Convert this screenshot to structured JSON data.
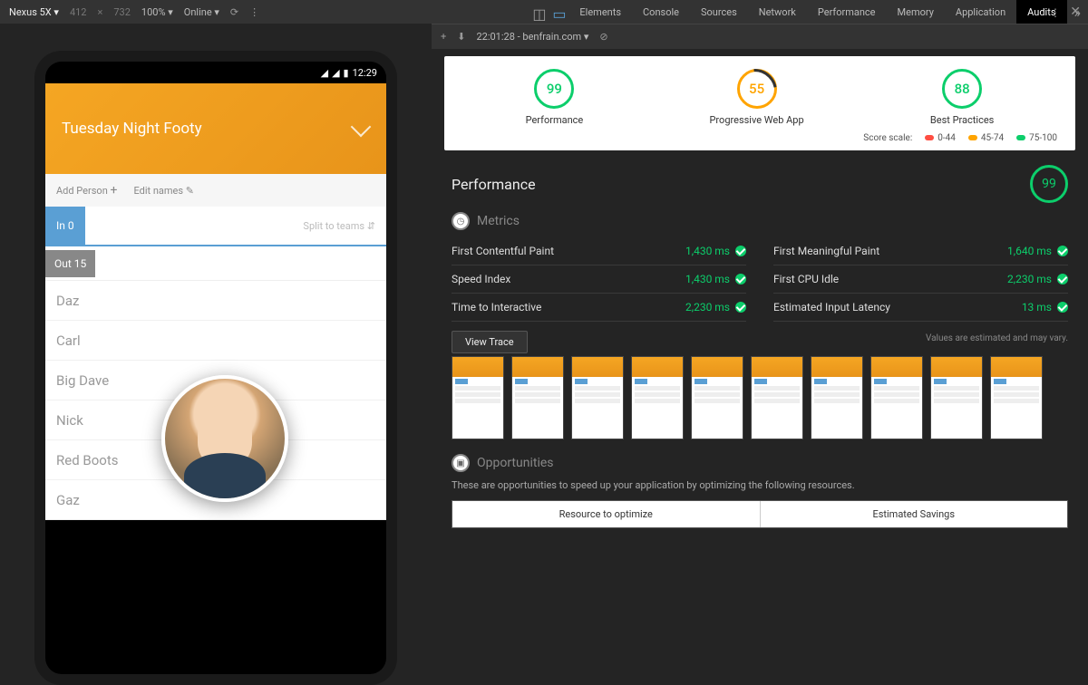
{
  "toolbar": {
    "device": "Nexus 5X ▾",
    "w": "412",
    "x": "×",
    "h": "732",
    "zoom": "100% ▾",
    "network": "Online ▾"
  },
  "devtools_tabs": [
    "Elements",
    "Console",
    "Sources",
    "Network",
    "Performance",
    "Memory",
    "Application",
    "Audits"
  ],
  "subbar": {
    "timestamp": "22:01:28 - benfrain.com ▾"
  },
  "phone": {
    "time": "12:29",
    "title": "Tuesday Night Footy",
    "add_person": "Add Person",
    "edit_names": "Edit names",
    "tab_in": "In  0",
    "split": "Split to teams",
    "tab_out": "Out  15",
    "names": [
      "Daz",
      "Carl",
      "Big Dave",
      "Nick",
      "Red Boots",
      "Gaz"
    ]
  },
  "scores": {
    "perf": {
      "value": "99",
      "label": "Performance"
    },
    "pwa": {
      "value": "55",
      "label": "Progressive Web App"
    },
    "bp": {
      "value": "88",
      "label": "Best Practices"
    },
    "scale_label": "Score scale:",
    "r": "0-44",
    "o": "45-74",
    "g": "75-100"
  },
  "section": {
    "title": "Performance",
    "big": "99",
    "metrics_label": "Metrics",
    "metrics": [
      {
        "name": "First Contentful Paint",
        "val": "1,430 ms"
      },
      {
        "name": "First Meaningful Paint",
        "val": "1,640 ms"
      },
      {
        "name": "Speed Index",
        "val": "1,430 ms"
      },
      {
        "name": "First CPU Idle",
        "val": "2,230 ms"
      },
      {
        "name": "Time to Interactive",
        "val": "2,230 ms"
      },
      {
        "name": "Estimated Input Latency",
        "val": "13 ms"
      }
    ],
    "view_trace": "View Trace",
    "est_note": "Values are estimated and may vary.",
    "opp_label": "Opportunities",
    "opp_text": "These are opportunities to speed up your application by optimizing the following resources.",
    "opp_cols": [
      "Resource to optimize",
      "Estimated Savings"
    ]
  }
}
